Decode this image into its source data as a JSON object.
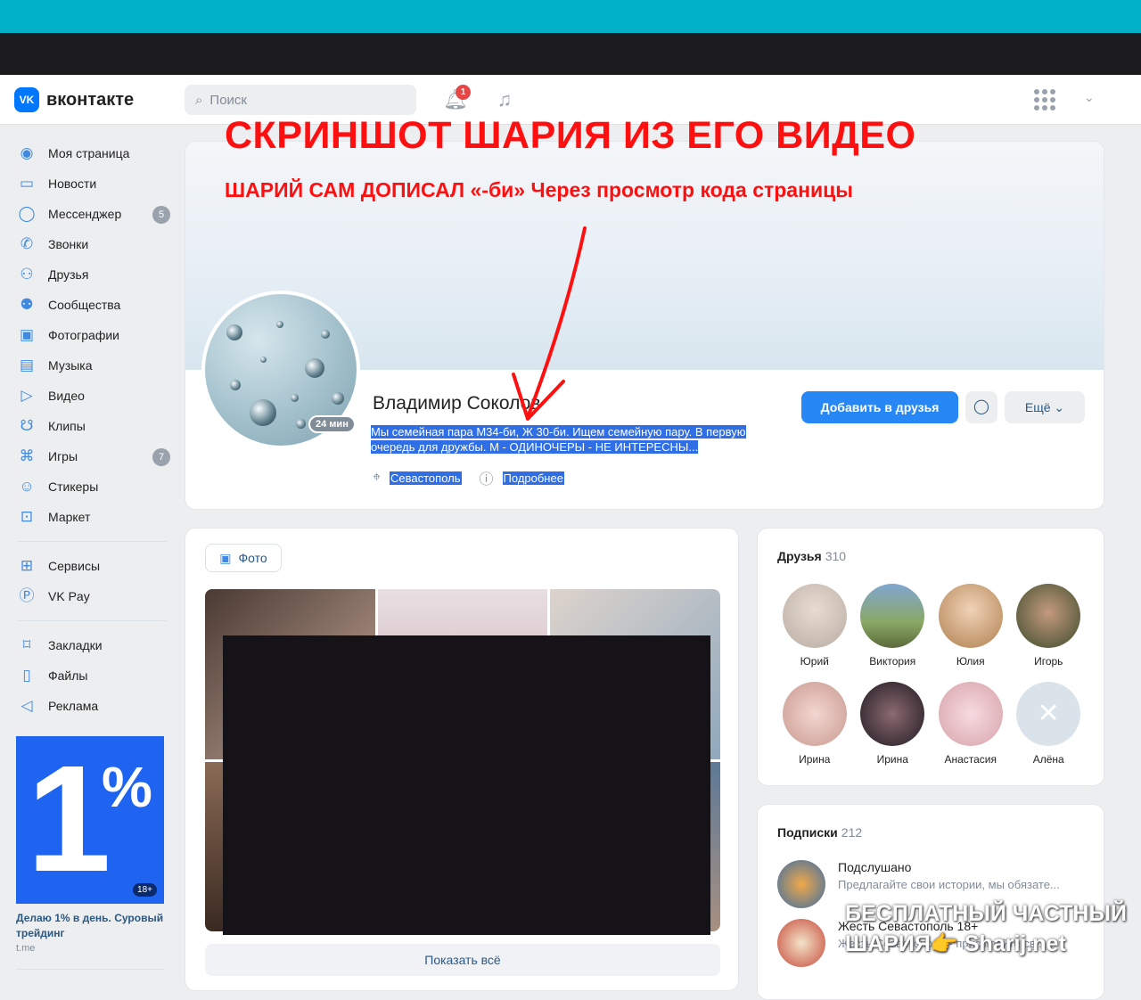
{
  "header": {
    "logo_mark": "VK",
    "logo_text": "вконтакте",
    "search_placeholder": "Поиск",
    "notification_count": "1"
  },
  "sidebar": {
    "items": [
      {
        "label": "Моя страница",
        "icon": "user-icon"
      },
      {
        "label": "Новости",
        "icon": "news-icon"
      },
      {
        "label": "Мессенджер",
        "icon": "message-icon",
        "count": "5"
      },
      {
        "label": "Звонки",
        "icon": "phone-icon"
      },
      {
        "label": "Друзья",
        "icon": "friends-icon"
      },
      {
        "label": "Сообщества",
        "icon": "communities-icon"
      },
      {
        "label": "Фотографии",
        "icon": "photo-icon"
      },
      {
        "label": "Музыка",
        "icon": "music-icon"
      },
      {
        "label": "Видео",
        "icon": "video-icon"
      },
      {
        "label": "Клипы",
        "icon": "clips-icon"
      },
      {
        "label": "Игры",
        "icon": "games-icon",
        "count": "7"
      },
      {
        "label": "Стикеры",
        "icon": "stickers-icon"
      },
      {
        "label": "Маркет",
        "icon": "market-icon"
      }
    ],
    "items2": [
      {
        "label": "Сервисы",
        "icon": "services-icon"
      },
      {
        "label": "VK Pay",
        "icon": "vkpay-icon"
      }
    ],
    "items3": [
      {
        "label": "Закладки",
        "icon": "bookmark-icon"
      },
      {
        "label": "Файлы",
        "icon": "file-icon"
      },
      {
        "label": "Реклама",
        "icon": "ads-icon"
      }
    ]
  },
  "ad": {
    "big": "1",
    "pct": "%",
    "age": "18+",
    "text": "Делаю 1% в день. Суровый трейдинг",
    "site": "t.me"
  },
  "annotation": {
    "title": "СКРИНШОТ ШАРИЯ ИЗ ЕГО ВИДЕО",
    "subtitle": "ШАРИЙ САМ ДОПИСАЛ «-би» Через просмотр кода страницы"
  },
  "profile": {
    "name": "Владимир Соколов",
    "online": "24 мин",
    "status": "Мы семейная пара М34-би, Ж 30-би. Ищем семейную пару. В первую очередь для дружбы. М - ОДИНОЧЕРЫ - НЕ ИНТЕРЕСНЫ...",
    "city": "Севастополь",
    "more_info": "Подробнее",
    "add_friend": "Добавить в друзья",
    "more_btn": "Ещё"
  },
  "photos": {
    "tab": "Фото",
    "show_all": "Показать всё"
  },
  "friends": {
    "title": "Друзья",
    "count": "310",
    "list": [
      {
        "name": "Юрий",
        "color": "#d9d2cc"
      },
      {
        "name": "Виктория",
        "color": "#6f8fb0"
      },
      {
        "name": "Юлия",
        "color": "#c9a07e"
      },
      {
        "name": "Игорь",
        "color": "#4e5a3a"
      },
      {
        "name": "Ирина",
        "color": "#e2b9b0"
      },
      {
        "name": "Ирина",
        "color": "#3b2f3a"
      },
      {
        "name": "Анастасия",
        "color": "#e8c6c8"
      },
      {
        "name": "Алёна",
        "color": "#dbe3ea"
      }
    ]
  },
  "subscriptions": {
    "title": "Подписки",
    "count": "212",
    "list": [
      {
        "title": "Подслушано",
        "sub": "Предлагайте свои истории, мы обязате..."
      },
      {
        "title": "Жесть Севастополь 18+",
        "sub": "Жесть Севастополя - присылайте св..."
      }
    ]
  },
  "watermark": {
    "line1": "БЕСПЛАТНЫЙ ЧАСТНЫЙ",
    "line2": "ШАРИЯ👉 Sharij.net"
  }
}
